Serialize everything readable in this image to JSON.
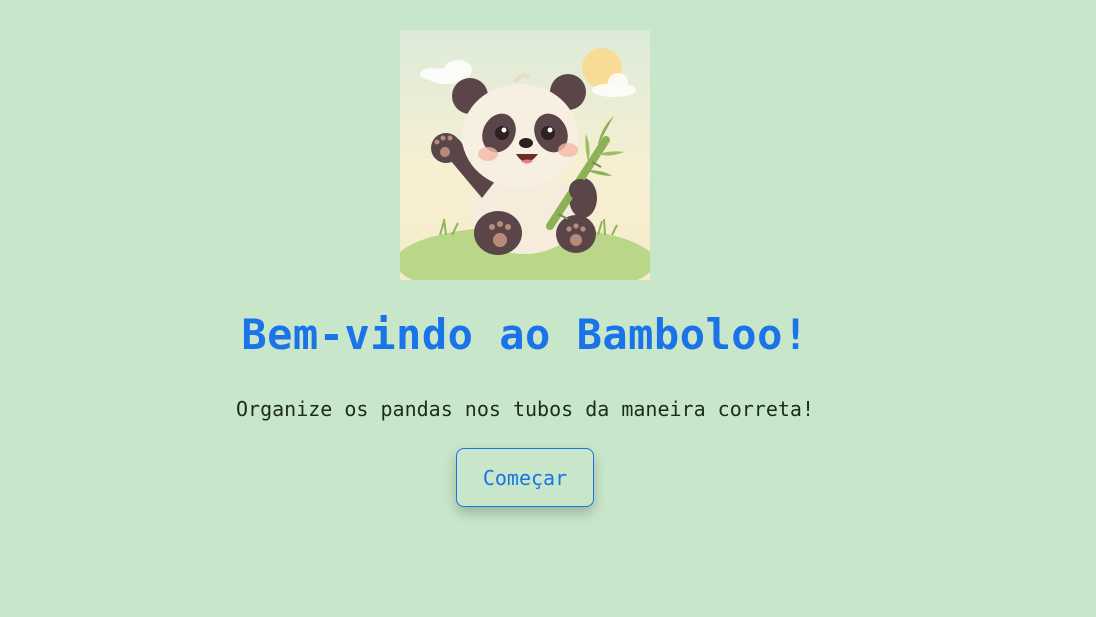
{
  "welcome": {
    "title": "Bem-vindo ao Bamboloo!",
    "subtitle": "Organize os pandas nos tubos da maneira correta!",
    "start_label": "Começar"
  },
  "mascot": {
    "icon": "panda-with-bamboo-illustration"
  },
  "colors": {
    "background": "#c8e6c9",
    "accent": "#1a73e8",
    "text": "#1d2b1d"
  }
}
